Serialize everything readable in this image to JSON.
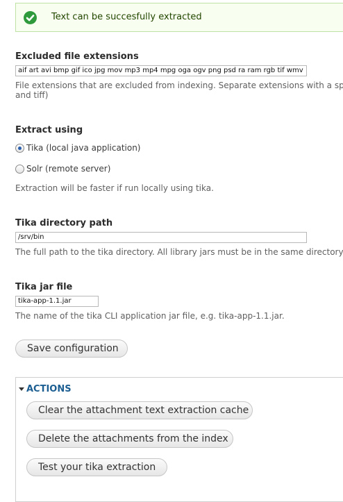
{
  "status": {
    "message": "Text can be succesfully extracted",
    "icon": "check-circle-icon",
    "color": "#2f9a3c"
  },
  "excluded": {
    "label": "Excluded file extensions",
    "value": "aif art avi bmp gif ico jpg mov mp3 mp4 mpg oga ogv png psd ra ram rgb tif wmv",
    "description_line1": "File extensions that are excluded from indexing. Separate extensions with a spac",
    "description_line2": "and tiff)"
  },
  "extract": {
    "label": "Extract using",
    "options": [
      {
        "label": "Tika (local java application)",
        "selected": true
      },
      {
        "label": "Solr (remote server)",
        "selected": false
      }
    ],
    "description": "Extraction will be faster if run locally using tika."
  },
  "tika_path": {
    "label": "Tika directory path",
    "value": "/srv/bin",
    "description": "The full path to the tika directory. All library jars must be in the same directory. I"
  },
  "tika_jar": {
    "label": "Tika jar file",
    "value": "tika-app-1.1.jar",
    "description": "The name of the tika CLI application jar file, e.g. tika-app-1.1.jar."
  },
  "save_button": "Save configuration",
  "actions": {
    "legend": "ACTIONS",
    "buttons": [
      "Clear the attachment text extraction cache",
      "Delete the attachments from the index",
      "Test your tika extraction"
    ]
  }
}
